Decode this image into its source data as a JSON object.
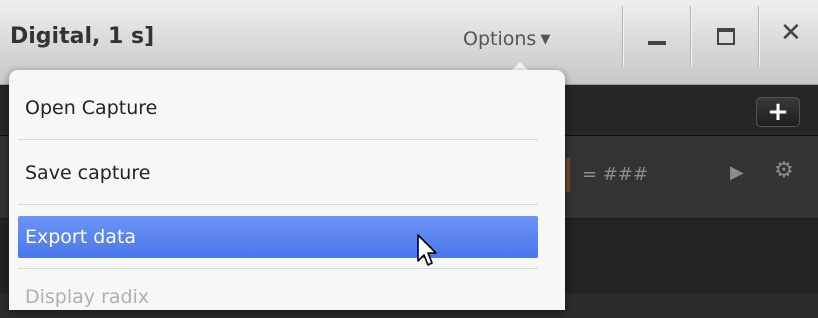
{
  "window": {
    "title": "Digital, 1 s]",
    "options_label": "Options",
    "minimize_icon": "minimize-icon",
    "maximize_icon": "maximize-icon",
    "close_icon": "close-icon"
  },
  "toolbar": {
    "add_label": "+"
  },
  "channel": {
    "value_text": "= ###",
    "play_icon": "play-icon",
    "settings_icon": "gear-icon"
  },
  "menu": {
    "items": [
      {
        "label": "Open Capture",
        "state": "normal"
      },
      {
        "label": "Save capture",
        "state": "normal"
      },
      {
        "label": "Export data",
        "state": "selected"
      },
      {
        "label": "Display radix",
        "state": "partially-visible"
      }
    ]
  },
  "colors": {
    "selection": "#4a76ee",
    "menu_bg": "#f7f7f7",
    "app_bg": "#2b2b2b"
  }
}
